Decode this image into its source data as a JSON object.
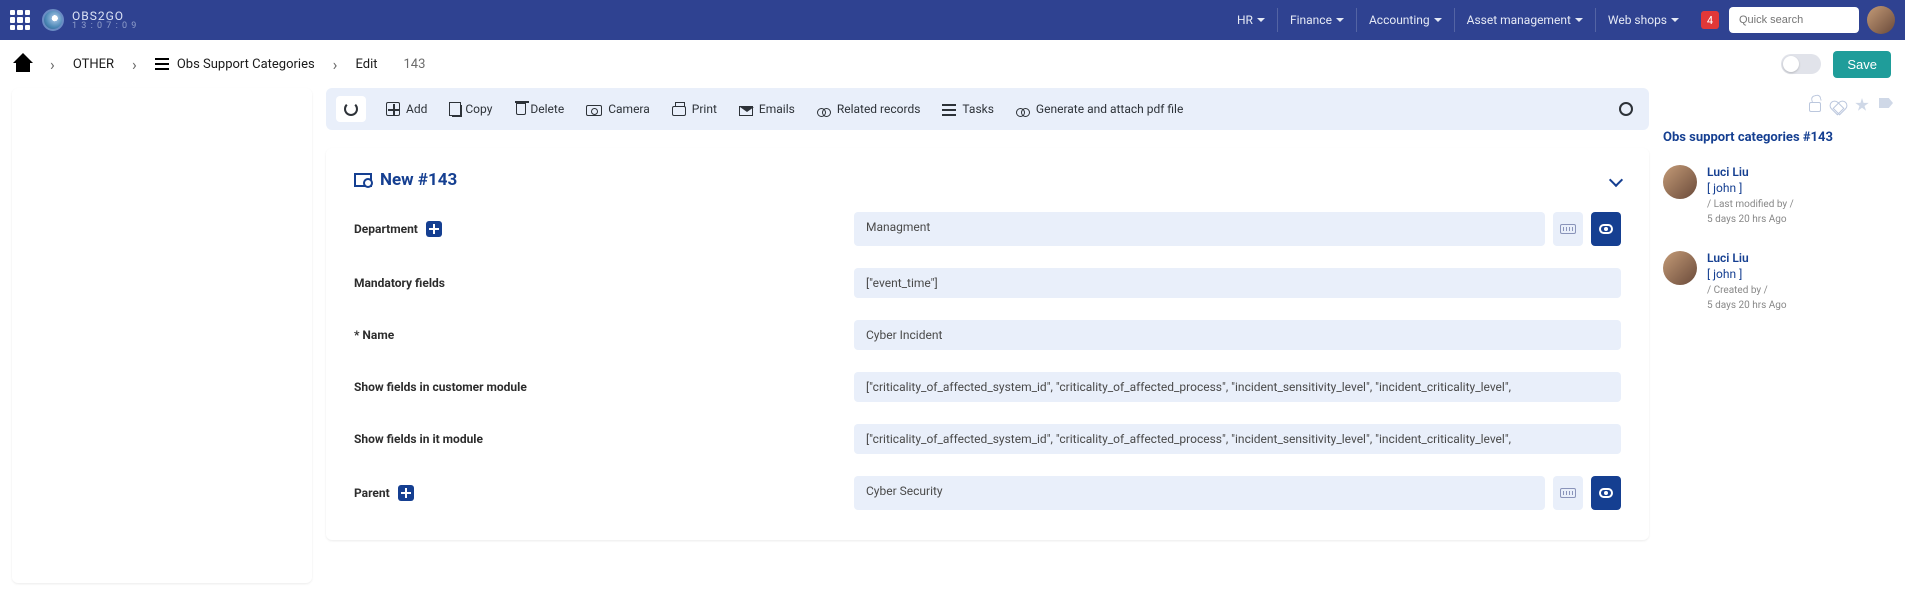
{
  "header": {
    "brand": "OBS2GO",
    "clock": "1 3 : 0 7 : 0 9",
    "nav": [
      "HR",
      "Finance",
      "Accounting",
      "Asset management",
      "Web shops"
    ],
    "badge": "4",
    "search_placeholder": "Quick search"
  },
  "breadcrumb": {
    "item1": "OTHER",
    "item2": "Obs Support Categories",
    "item3": "Edit",
    "id": "143",
    "save": "Save"
  },
  "toolbar": {
    "add": "Add",
    "copy": "Copy",
    "delete": "Delete",
    "camera": "Camera",
    "print": "Print",
    "emails": "Emails",
    "related": "Related records",
    "tasks": "Tasks",
    "pdf": "Generate and attach pdf file"
  },
  "card": {
    "title": "New #143",
    "fields": {
      "department": {
        "label": "Department",
        "value": "Managment"
      },
      "mandatory": {
        "label": "Mandatory fields",
        "value": "[\"event_time\"]"
      },
      "name": {
        "label": "* Name",
        "value": "Cyber Incident"
      },
      "show_cust": {
        "label": "Show fields in customer module",
        "value": "[\"criticality_of_affected_system_id\", \"criticality_of_affected_process\", \"incident_sensitivity_level\", \"incident_criticality_level\","
      },
      "show_it": {
        "label": "Show fields in it module",
        "value": "[\"criticality_of_affected_system_id\", \"criticality_of_affected_process\", \"incident_sensitivity_level\", \"incident_criticality_level\","
      },
      "parent": {
        "label": "Parent",
        "value": "Cyber Security"
      }
    }
  },
  "sidebar": {
    "title": "Obs support categories #143",
    "entries": [
      {
        "name": "Luci Liu",
        "user": "[ john ]",
        "meta1": "/ Last modified by /",
        "meta2": "5 days 20 hrs Ago"
      },
      {
        "name": "Luci Liu",
        "user": "[ john ]",
        "meta1": "/ Created by /",
        "meta2": "5 days 20 hrs Ago"
      }
    ]
  }
}
